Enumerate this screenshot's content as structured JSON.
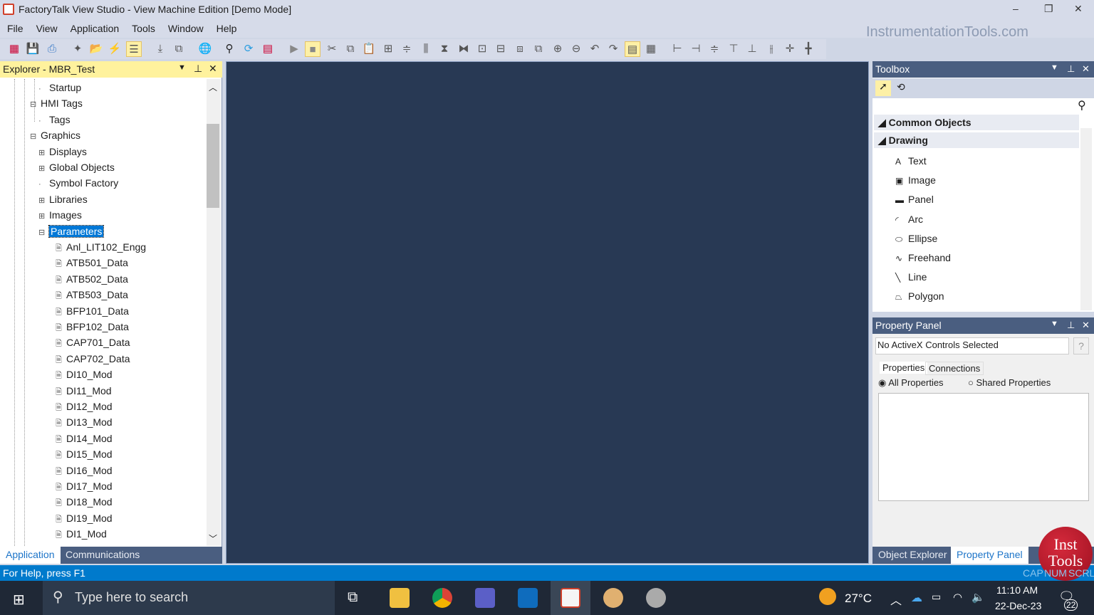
{
  "window": {
    "title": "FactoryTalk View Studio - View Machine Edition  [Demo Mode]",
    "minimize": "‒",
    "maximize": "❐",
    "close": "✕"
  },
  "menu": [
    "File",
    "View",
    "Application",
    "Tools",
    "Window",
    "Help"
  ],
  "watermark": "InstrumentationTools.com",
  "explorer": {
    "title": "Explorer - MBR_Test",
    "tree": [
      {
        "label": "Startup",
        "icon": "startup-icon",
        "level": 2
      },
      {
        "label": "HMI Tags",
        "icon": "folder-icon",
        "level": 1,
        "expander": "−"
      },
      {
        "label": "Tags",
        "icon": "tag-icon",
        "level": 2
      },
      {
        "label": "Graphics",
        "icon": "folder-icon",
        "level": 1,
        "expander": "−"
      },
      {
        "label": "Displays",
        "icon": "displays-icon",
        "level": 2,
        "expander": "+"
      },
      {
        "label": "Global Objects",
        "icon": "global-objects-icon",
        "level": 2,
        "expander": "+"
      },
      {
        "label": "Symbol Factory",
        "icon": "symbol-factory-icon",
        "level": 2
      },
      {
        "label": "Libraries",
        "icon": "libraries-icon",
        "level": 2,
        "expander": "+"
      },
      {
        "label": "Images",
        "icon": "images-icon",
        "level": 2,
        "expander": "+"
      },
      {
        "label": "Parameters",
        "icon": "parameters-icon",
        "level": 2,
        "expander": "−",
        "selected": true
      },
      {
        "label": "Anl_LIT102_Engg",
        "level": 3
      },
      {
        "label": "ATB501_Data",
        "level": 3
      },
      {
        "label": "ATB502_Data",
        "level": 3
      },
      {
        "label": "ATB503_Data",
        "level": 3
      },
      {
        "label": "BFP101_Data",
        "level": 3
      },
      {
        "label": "BFP102_Data",
        "level": 3
      },
      {
        "label": "CAP701_Data",
        "level": 3
      },
      {
        "label": "CAP702_Data",
        "level": 3
      },
      {
        "label": "DI10_Mod",
        "level": 3
      },
      {
        "label": "DI11_Mod",
        "level": 3
      },
      {
        "label": "DI12_Mod",
        "level": 3
      },
      {
        "label": "DI13_Mod",
        "level": 3
      },
      {
        "label": "DI14_Mod",
        "level": 3
      },
      {
        "label": "DI15_Mod",
        "level": 3
      },
      {
        "label": "DI16_Mod",
        "level": 3
      },
      {
        "label": "DI17_Mod",
        "level": 3
      },
      {
        "label": "DI18_Mod",
        "level": 3
      },
      {
        "label": "DI19_Mod",
        "level": 3
      },
      {
        "label": "DI1_Mod",
        "level": 3
      }
    ],
    "tabs": [
      "Application",
      "Communications"
    ]
  },
  "toolbox": {
    "title": "Toolbox",
    "categories": [
      "Common Objects",
      "Drawing"
    ],
    "items": [
      {
        "label": "Text",
        "icon": "A"
      },
      {
        "label": "Image",
        "icon": "▣"
      },
      {
        "label": "Panel",
        "icon": "▬"
      },
      {
        "label": "Arc",
        "icon": "◜"
      },
      {
        "label": "Ellipse",
        "icon": "⬭"
      },
      {
        "label": "Freehand",
        "icon": "∿"
      },
      {
        "label": "Line",
        "icon": "╲"
      },
      {
        "label": "Polygon",
        "icon": "⏢"
      }
    ]
  },
  "property_panel": {
    "title": "Property Panel",
    "selection": "No ActiveX Controls Selected",
    "help": "?",
    "tabs": [
      "Properties",
      "Connections"
    ],
    "radios": [
      {
        "label": "All Properties",
        "checked": true
      },
      {
        "label": "Shared Properties",
        "checked": false
      }
    ]
  },
  "right_tabs": [
    "Object Explorer",
    "Property Panel"
  ],
  "status": {
    "help": "For Help, press F1",
    "caps": "CAP",
    "num": "NUM",
    "scrl": "SCRL"
  },
  "logo": {
    "line1": "Inst",
    "line2": "Tools"
  },
  "taskbar": {
    "search_placeholder": "Type here to search",
    "weather": "27°C",
    "time": "11:10 AM",
    "date": "22-Dec-23",
    "notifications": "22"
  }
}
